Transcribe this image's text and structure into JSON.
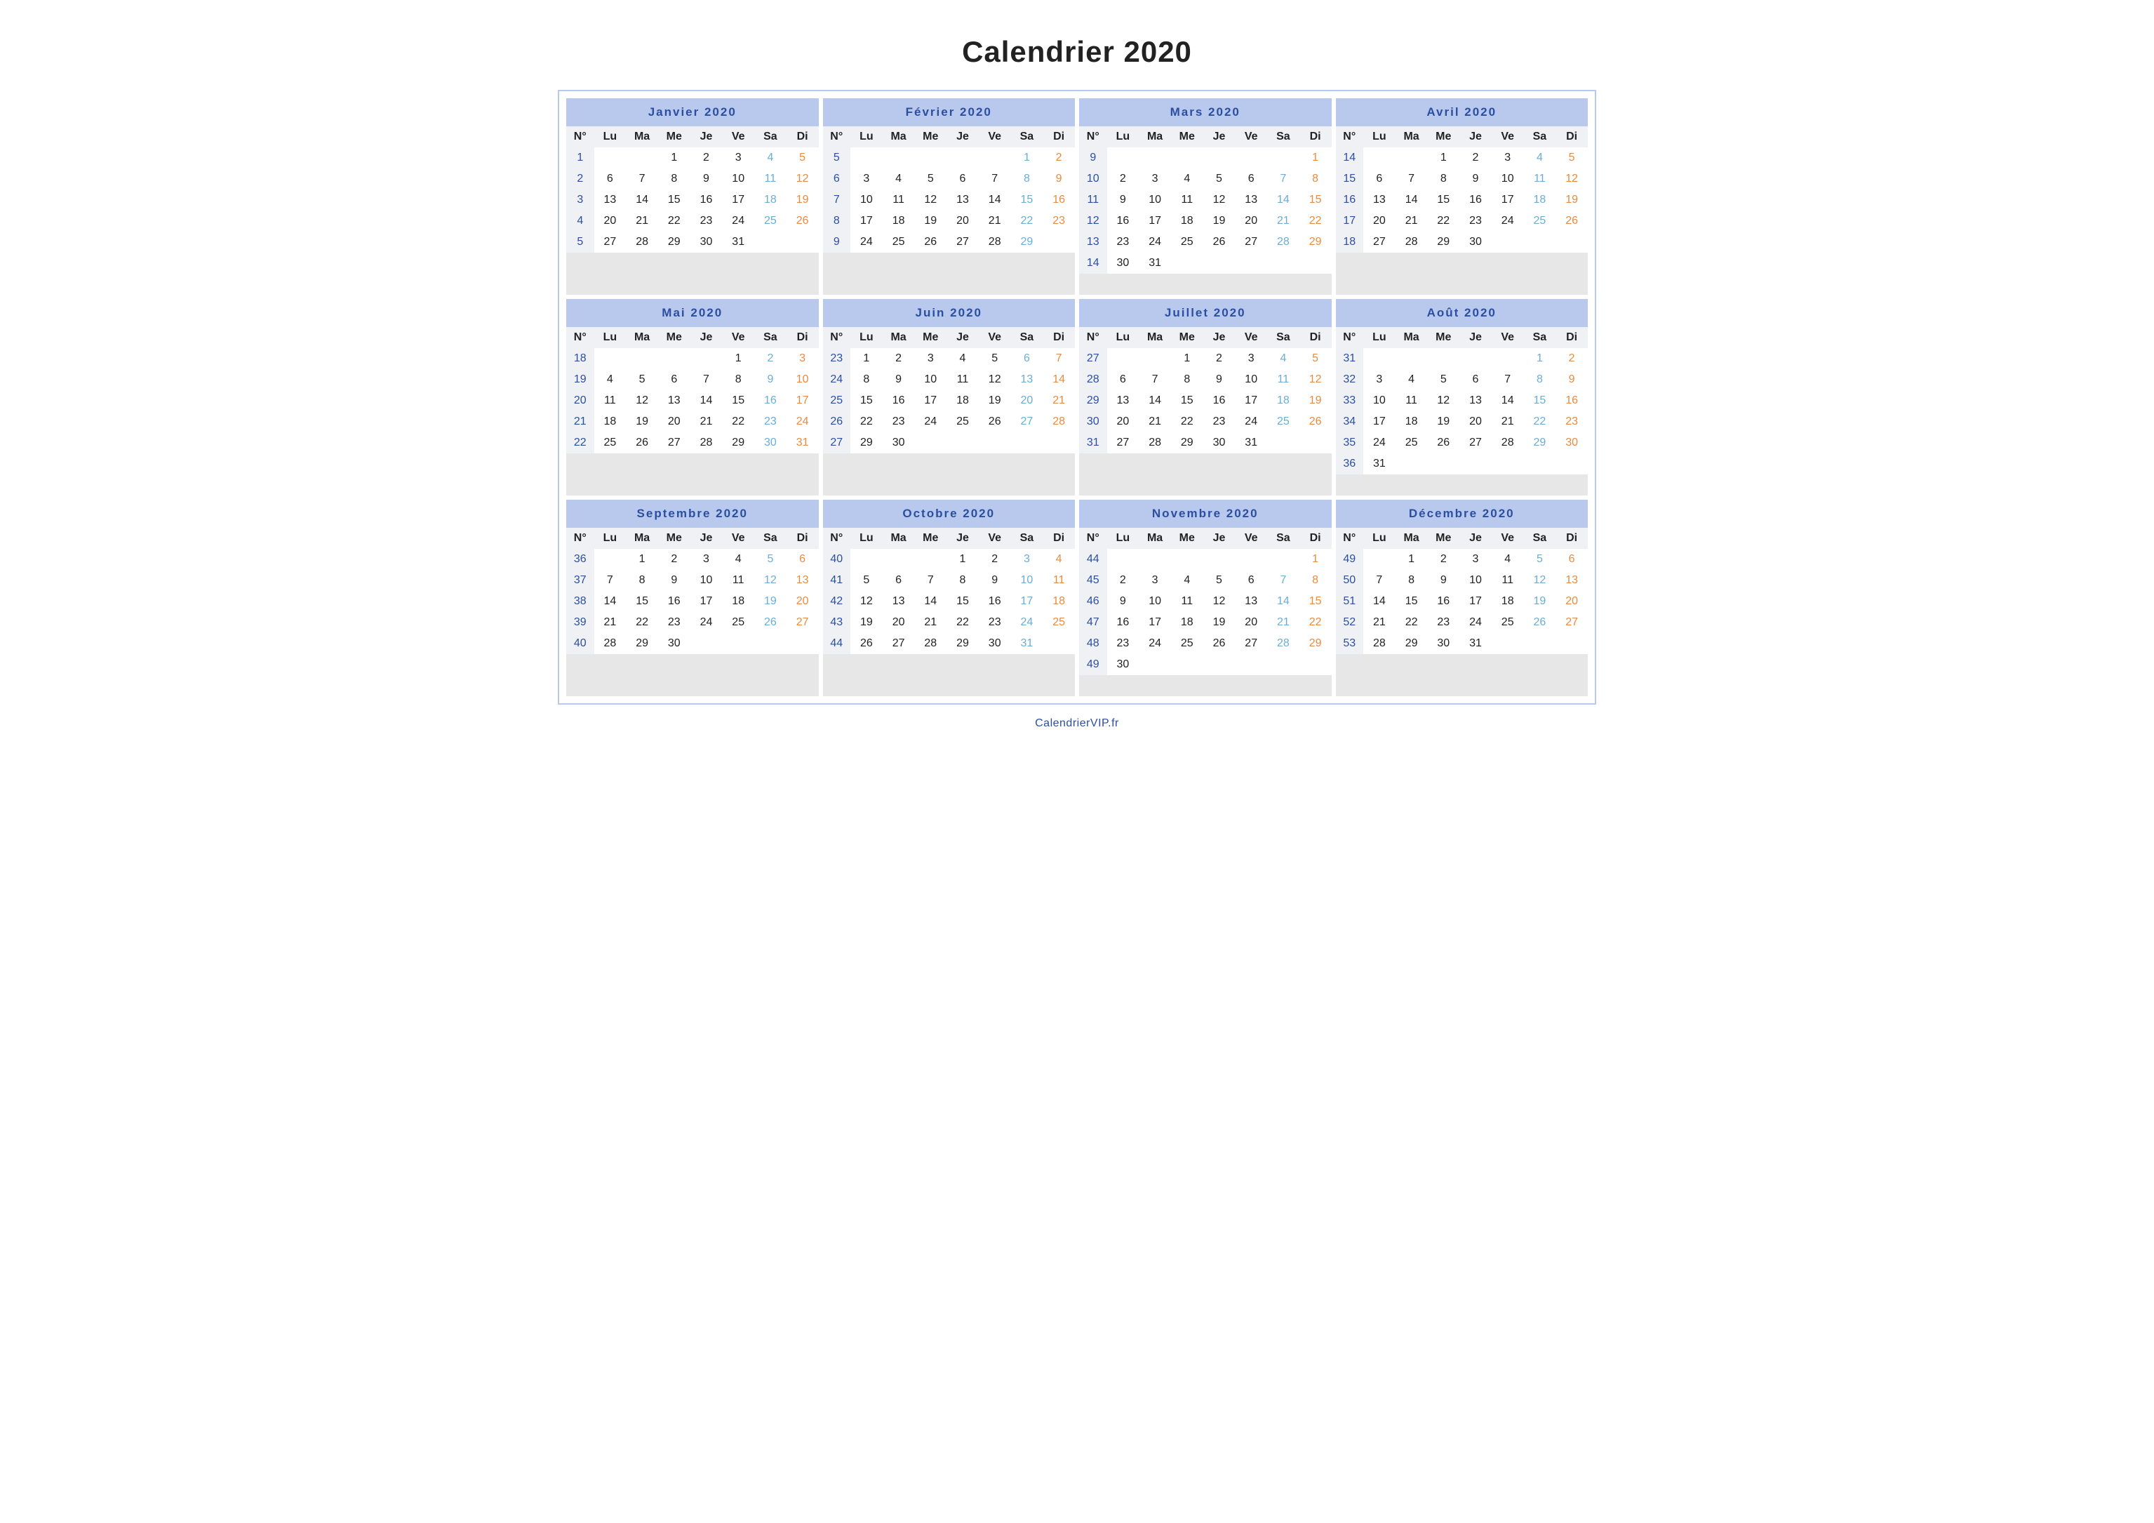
{
  "title": "Calendrier 2020",
  "footer": "CalendrierVIP.fr",
  "day_headers": [
    "N°",
    "Lu",
    "Ma",
    "Me",
    "Je",
    "Ve",
    "Sa",
    "Di"
  ],
  "max_rows": 7,
  "months": [
    {
      "name": "Janvier 2020",
      "weeks": [
        {
          "n": 1,
          "days": [
            "",
            "",
            "1",
            "2",
            "3",
            "4",
            "5"
          ]
        },
        {
          "n": 2,
          "days": [
            "6",
            "7",
            "8",
            "9",
            "10",
            "11",
            "12"
          ]
        },
        {
          "n": 3,
          "days": [
            "13",
            "14",
            "15",
            "16",
            "17",
            "18",
            "19"
          ]
        },
        {
          "n": 4,
          "days": [
            "20",
            "21",
            "22",
            "23",
            "24",
            "25",
            "26"
          ]
        },
        {
          "n": 5,
          "days": [
            "27",
            "28",
            "29",
            "30",
            "31",
            "",
            ""
          ]
        }
      ]
    },
    {
      "name": "Février 2020",
      "weeks": [
        {
          "n": 5,
          "days": [
            "",
            "",
            "",
            "",
            "",
            "1",
            "2"
          ]
        },
        {
          "n": 6,
          "days": [
            "3",
            "4",
            "5",
            "6",
            "7",
            "8",
            "9"
          ]
        },
        {
          "n": 7,
          "days": [
            "10",
            "11",
            "12",
            "13",
            "14",
            "15",
            "16"
          ]
        },
        {
          "n": 8,
          "days": [
            "17",
            "18",
            "19",
            "20",
            "21",
            "22",
            "23"
          ]
        },
        {
          "n": 9,
          "days": [
            "24",
            "25",
            "26",
            "27",
            "28",
            "29",
            ""
          ]
        }
      ]
    },
    {
      "name": "Mars 2020",
      "weeks": [
        {
          "n": 9,
          "days": [
            "",
            "",
            "",
            "",
            "",
            "",
            "1"
          ]
        },
        {
          "n": 10,
          "days": [
            "2",
            "3",
            "4",
            "5",
            "6",
            "7",
            "8"
          ]
        },
        {
          "n": 11,
          "days": [
            "9",
            "10",
            "11",
            "12",
            "13",
            "14",
            "15"
          ]
        },
        {
          "n": 12,
          "days": [
            "16",
            "17",
            "18",
            "19",
            "20",
            "21",
            "22"
          ]
        },
        {
          "n": 13,
          "days": [
            "23",
            "24",
            "25",
            "26",
            "27",
            "28",
            "29"
          ]
        },
        {
          "n": 14,
          "days": [
            "30",
            "31",
            "",
            "",
            "",
            "",
            ""
          ]
        }
      ]
    },
    {
      "name": "Avril 2020",
      "weeks": [
        {
          "n": 14,
          "days": [
            "",
            "",
            "1",
            "2",
            "3",
            "4",
            "5"
          ]
        },
        {
          "n": 15,
          "days": [
            "6",
            "7",
            "8",
            "9",
            "10",
            "11",
            "12"
          ]
        },
        {
          "n": 16,
          "days": [
            "13",
            "14",
            "15",
            "16",
            "17",
            "18",
            "19"
          ]
        },
        {
          "n": 17,
          "days": [
            "20",
            "21",
            "22",
            "23",
            "24",
            "25",
            "26"
          ]
        },
        {
          "n": 18,
          "days": [
            "27",
            "28",
            "29",
            "30",
            "",
            "",
            ""
          ]
        }
      ]
    },
    {
      "name": "Mai 2020",
      "weeks": [
        {
          "n": 18,
          "days": [
            "",
            "",
            "",
            "",
            "1",
            "2",
            "3"
          ]
        },
        {
          "n": 19,
          "days": [
            "4",
            "5",
            "6",
            "7",
            "8",
            "9",
            "10"
          ]
        },
        {
          "n": 20,
          "days": [
            "11",
            "12",
            "13",
            "14",
            "15",
            "16",
            "17"
          ]
        },
        {
          "n": 21,
          "days": [
            "18",
            "19",
            "20",
            "21",
            "22",
            "23",
            "24"
          ]
        },
        {
          "n": 22,
          "days": [
            "25",
            "26",
            "27",
            "28",
            "29",
            "30",
            "31"
          ]
        }
      ]
    },
    {
      "name": "Juin 2020",
      "weeks": [
        {
          "n": 23,
          "days": [
            "1",
            "2",
            "3",
            "4",
            "5",
            "6",
            "7"
          ]
        },
        {
          "n": 24,
          "days": [
            "8",
            "9",
            "10",
            "11",
            "12",
            "13",
            "14"
          ]
        },
        {
          "n": 25,
          "days": [
            "15",
            "16",
            "17",
            "18",
            "19",
            "20",
            "21"
          ]
        },
        {
          "n": 26,
          "days": [
            "22",
            "23",
            "24",
            "25",
            "26",
            "27",
            "28"
          ]
        },
        {
          "n": 27,
          "days": [
            "29",
            "30",
            "",
            "",
            "",
            "",
            ""
          ]
        }
      ]
    },
    {
      "name": "Juillet 2020",
      "weeks": [
        {
          "n": 27,
          "days": [
            "",
            "",
            "1",
            "2",
            "3",
            "4",
            "5"
          ]
        },
        {
          "n": 28,
          "days": [
            "6",
            "7",
            "8",
            "9",
            "10",
            "11",
            "12"
          ]
        },
        {
          "n": 29,
          "days": [
            "13",
            "14",
            "15",
            "16",
            "17",
            "18",
            "19"
          ]
        },
        {
          "n": 30,
          "days": [
            "20",
            "21",
            "22",
            "23",
            "24",
            "25",
            "26"
          ]
        },
        {
          "n": 31,
          "days": [
            "27",
            "28",
            "29",
            "30",
            "31",
            "",
            ""
          ]
        }
      ]
    },
    {
      "name": "Août 2020",
      "weeks": [
        {
          "n": 31,
          "days": [
            "",
            "",
            "",
            "",
            "",
            "1",
            "2"
          ]
        },
        {
          "n": 32,
          "days": [
            "3",
            "4",
            "5",
            "6",
            "7",
            "8",
            "9"
          ]
        },
        {
          "n": 33,
          "days": [
            "10",
            "11",
            "12",
            "13",
            "14",
            "15",
            "16"
          ]
        },
        {
          "n": 34,
          "days": [
            "17",
            "18",
            "19",
            "20",
            "21",
            "22",
            "23"
          ]
        },
        {
          "n": 35,
          "days": [
            "24",
            "25",
            "26",
            "27",
            "28",
            "29",
            "30"
          ]
        },
        {
          "n": 36,
          "days": [
            "31",
            "",
            "",
            "",
            "",
            "",
            ""
          ]
        }
      ]
    },
    {
      "name": "Septembre 2020",
      "weeks": [
        {
          "n": 36,
          "days": [
            "",
            "1",
            "2",
            "3",
            "4",
            "5",
            "6"
          ]
        },
        {
          "n": 37,
          "days": [
            "7",
            "8",
            "9",
            "10",
            "11",
            "12",
            "13"
          ]
        },
        {
          "n": 38,
          "days": [
            "14",
            "15",
            "16",
            "17",
            "18",
            "19",
            "20"
          ]
        },
        {
          "n": 39,
          "days": [
            "21",
            "22",
            "23",
            "24",
            "25",
            "26",
            "27"
          ]
        },
        {
          "n": 40,
          "days": [
            "28",
            "29",
            "30",
            "",
            "",
            "",
            ""
          ]
        }
      ]
    },
    {
      "name": "Octobre 2020",
      "weeks": [
        {
          "n": 40,
          "days": [
            "",
            "",
            "",
            "1",
            "2",
            "3",
            "4"
          ]
        },
        {
          "n": 41,
          "days": [
            "5",
            "6",
            "7",
            "8",
            "9",
            "10",
            "11"
          ]
        },
        {
          "n": 42,
          "days": [
            "12",
            "13",
            "14",
            "15",
            "16",
            "17",
            "18"
          ]
        },
        {
          "n": 43,
          "days": [
            "19",
            "20",
            "21",
            "22",
            "23",
            "24",
            "25"
          ]
        },
        {
          "n": 44,
          "days": [
            "26",
            "27",
            "28",
            "29",
            "30",
            "31",
            ""
          ]
        }
      ]
    },
    {
      "name": "Novembre 2020",
      "weeks": [
        {
          "n": 44,
          "days": [
            "",
            "",
            "",
            "",
            "",
            "",
            "1"
          ]
        },
        {
          "n": 45,
          "days": [
            "2",
            "3",
            "4",
            "5",
            "6",
            "7",
            "8"
          ]
        },
        {
          "n": 46,
          "days": [
            "9",
            "10",
            "11",
            "12",
            "13",
            "14",
            "15"
          ]
        },
        {
          "n": 47,
          "days": [
            "16",
            "17",
            "18",
            "19",
            "20",
            "21",
            "22"
          ]
        },
        {
          "n": 48,
          "days": [
            "23",
            "24",
            "25",
            "26",
            "27",
            "28",
            "29"
          ]
        },
        {
          "n": 49,
          "days": [
            "30",
            "",
            "",
            "",
            "",
            "",
            ""
          ]
        }
      ]
    },
    {
      "name": "Décembre 2020",
      "weeks": [
        {
          "n": 49,
          "days": [
            "",
            "1",
            "2",
            "3",
            "4",
            "5",
            "6"
          ]
        },
        {
          "n": 50,
          "days": [
            "7",
            "8",
            "9",
            "10",
            "11",
            "12",
            "13"
          ]
        },
        {
          "n": 51,
          "days": [
            "14",
            "15",
            "16",
            "17",
            "18",
            "19",
            "20"
          ]
        },
        {
          "n": 52,
          "days": [
            "21",
            "22",
            "23",
            "24",
            "25",
            "26",
            "27"
          ]
        },
        {
          "n": 53,
          "days": [
            "28",
            "29",
            "30",
            "31",
            "",
            "",
            ""
          ]
        }
      ]
    }
  ]
}
